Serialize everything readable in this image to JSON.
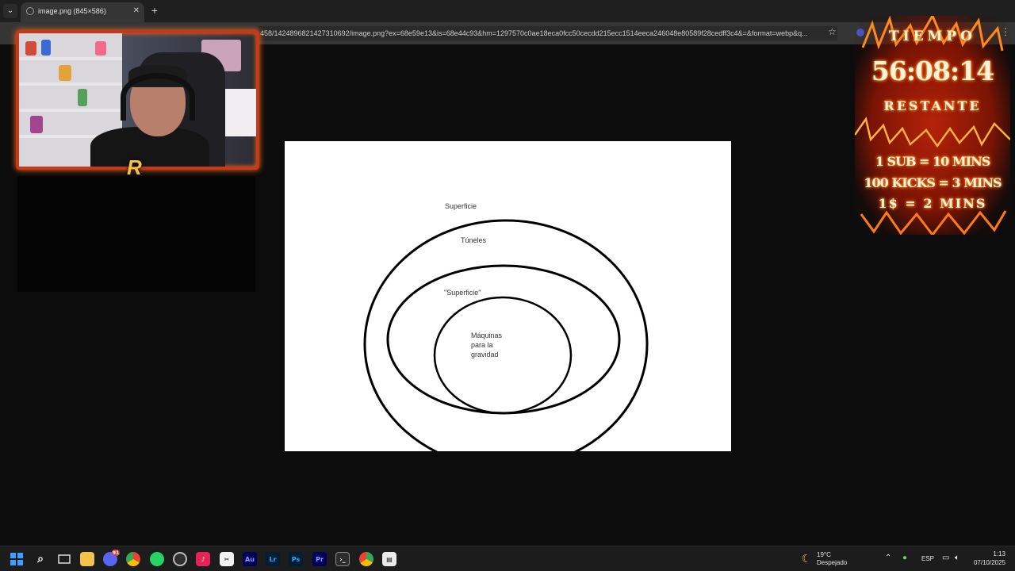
{
  "browser": {
    "tab_title": "image.png (845×586)",
    "url": "458/1424896821427310692/image.png?ex=68e59e13&is=68e44c93&hm=1297570c0ae18eca0fcc50cecdd215ecc1514eeca246048e80589f28cedff3c4&=&format=webp&q...",
    "icons": [
      "tab-dropdown-icon",
      "close-icon",
      "plus-icon",
      "star-icon",
      "extension-icon",
      "menu-icon"
    ]
  },
  "diagram": {
    "labels": {
      "surface": "Superficie",
      "tunnels": "Túneles",
      "inner_surface": "\"Superficie\"",
      "machines_1": "Máquinas",
      "machines_2": "para la",
      "machines_3": "gravidad"
    }
  },
  "timer": {
    "heading": "TIEMPO",
    "value": "56:08:14",
    "subheading": "RESTANTE",
    "rules": [
      "1 SUB = 10 MINS",
      "100 KICKS = 3 MINS",
      "1$ = 2 MINS"
    ]
  },
  "stream": {
    "logo": "R"
  },
  "taskbar": {
    "discord_badge": "91",
    "weather_temp": "19°C",
    "weather_desc": "Despejado",
    "language": "ESP",
    "time": "1:13",
    "date": "07/10/2025",
    "apps": [
      "start",
      "search",
      "task-view",
      "file-explorer",
      "discord",
      "chrome",
      "whatsapp",
      "obs",
      "tiktok",
      "capcut",
      "audition",
      "lightroom",
      "photoshop",
      "premiere",
      "terminal",
      "chrome-alt",
      "clapper"
    ],
    "app_labels": {
      "audition": "Au",
      "lightroom": "Lr",
      "photoshop": "Ps",
      "premiere": "Pr"
    },
    "colors": {
      "audition": "#00005b",
      "lightroom": "#001e36",
      "photoshop": "#001e36",
      "premiere": "#00005b"
    }
  }
}
